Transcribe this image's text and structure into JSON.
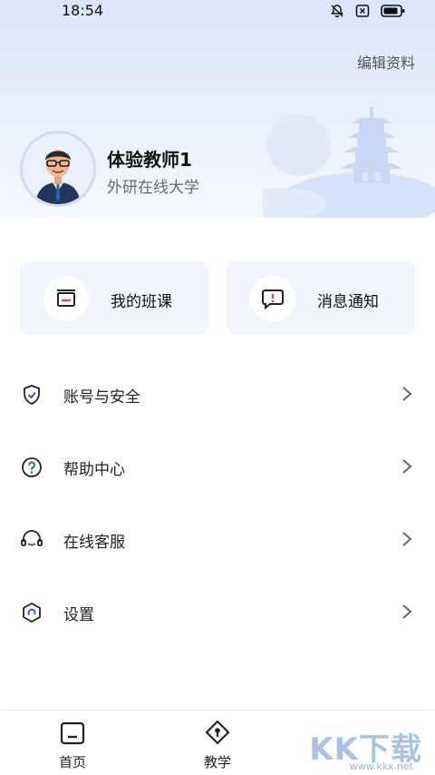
{
  "status_bar": {
    "time": "18:54"
  },
  "header": {
    "edit_label": "编辑资料"
  },
  "profile": {
    "name": "体验教师1",
    "school": "外研在线大学"
  },
  "quick_cards": [
    {
      "label": "我的班课",
      "icon": "classroom-icon"
    },
    {
      "label": "消息通知",
      "icon": "message-alert-icon"
    }
  ],
  "menu": [
    {
      "label": "账号与安全",
      "icon": "shield-check-icon"
    },
    {
      "label": "帮助中心",
      "icon": "question-circle-icon"
    },
    {
      "label": "在线客服",
      "icon": "headset-icon"
    },
    {
      "label": "设置",
      "icon": "settings-hex-icon"
    }
  ],
  "bottom_nav": [
    {
      "label": "首页",
      "icon": "home-icon"
    },
    {
      "label": "教学",
      "icon": "teaching-icon"
    }
  ],
  "watermark": {
    "brand": "KK下载",
    "url": "www.kkx.net"
  },
  "colors": {
    "accent": "#2a5fc7",
    "card_bg": "#f0f5fe",
    "hero_top": "#dbe6fb"
  }
}
